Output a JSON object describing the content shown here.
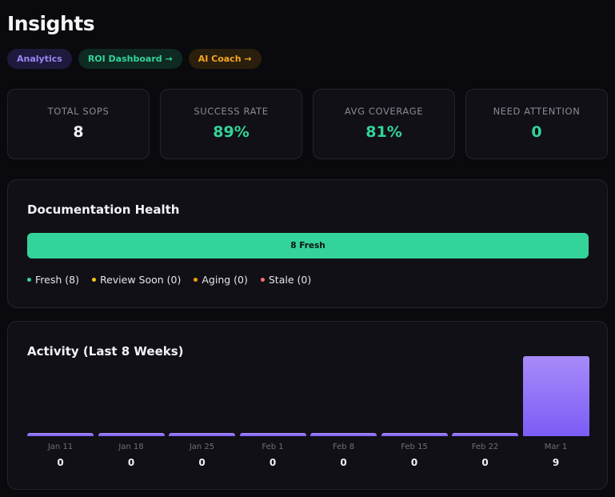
{
  "page": {
    "title": "Insights"
  },
  "chips": {
    "analytics": "Analytics",
    "roi": "ROI Dashboard →",
    "coach": "AI Coach →"
  },
  "stats": [
    {
      "label": "TOTAL SOPS",
      "value": "8",
      "color": "#f2f2f5"
    },
    {
      "label": "SUCCESS RATE",
      "value": "89%",
      "color": "#34d399"
    },
    {
      "label": "AVG COVERAGE",
      "value": "81%",
      "color": "#34d399"
    },
    {
      "label": "NEED ATTENTION",
      "value": "0",
      "color": "#34d399"
    }
  ],
  "health": {
    "title": "Documentation Health",
    "bar_label": "8 Fresh",
    "legend": [
      {
        "label": "Fresh (8)",
        "color": "#34d399"
      },
      {
        "label": "Review Soon (0)",
        "color": "#f5c518"
      },
      {
        "label": "Aging (0)",
        "color": "#f59e0b"
      },
      {
        "label": "Stale (0)",
        "color": "#f87171"
      }
    ]
  },
  "activity": {
    "title": "Activity (Last 8 Weeks)"
  },
  "chart_data": {
    "type": "bar",
    "categories": [
      "Jan 11",
      "Jan 18",
      "Jan 25",
      "Feb 1",
      "Feb 8",
      "Feb 15",
      "Feb 22",
      "Mar 1"
    ],
    "values": [
      0,
      0,
      0,
      0,
      0,
      0,
      0,
      9
    ],
    "title": "Activity (Last 8 Weeks)",
    "xlabel": "",
    "ylabel": "",
    "ylim": [
      0,
      9
    ],
    "grid": false,
    "bar_color": "#8b6cf7"
  }
}
